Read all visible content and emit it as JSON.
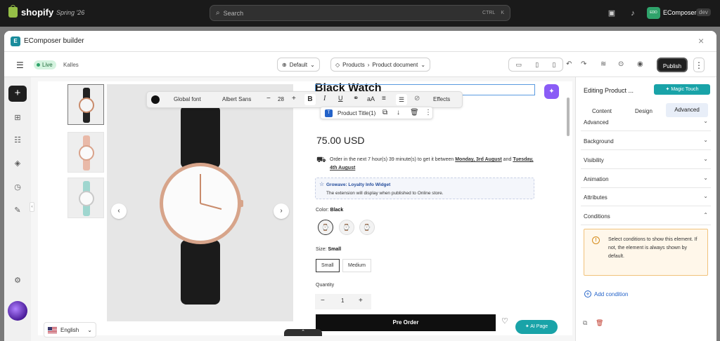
{
  "topbar": {
    "brand": "shopify",
    "edition": "Spring '26",
    "search_placeholder": "Search",
    "shortcut_ctrl": "CTRL",
    "shortcut_key": "K",
    "store_initials": "EDD",
    "store_name": "EComposer",
    "env": "dev"
  },
  "window": {
    "logo": "E",
    "title": "EComposer builder",
    "close": "×"
  },
  "toolbar": {
    "status": "Live",
    "theme": "Kalles",
    "device_mode": "Default",
    "breadcrumb_root": "Products",
    "breadcrumb_sep": "›",
    "breadcrumb_page": "Product document",
    "publish_label": "Publish"
  },
  "canvas": {
    "product_title": "Black Watch",
    "price": "75.00 USD",
    "order_text": "Order in the next 7 hour(s) 39 minute(s) to get it between",
    "order_from": "Monday, 3rd August",
    "order_and": "and",
    "order_to": "Tuesday, 4th August",
    "loyalty_title": "Growave: Loyalty Info Widget",
    "loyalty_desc": "The extension will display when published to Online store.",
    "color_label": "Color:",
    "color_value": "Black",
    "size_label": "Size:",
    "size_value": "Small",
    "size_options": [
      "Small",
      "Medium"
    ],
    "quantity_label": "Quantity",
    "quantity_value": "1",
    "preorder_label": "Pre Order",
    "ai_page_label": "AI Page",
    "language": "English"
  },
  "text_toolbar": {
    "font_scope": "Global font",
    "font_family": "Albert Sans",
    "font_size": "28",
    "bold": "B",
    "italic": "I",
    "underline": "U",
    "case": "aA",
    "effects": "Effects",
    "element_label": "Product Title(1)"
  },
  "panel": {
    "title": "Editing Product ...",
    "magic_touch": "Magic Touch",
    "tabs": [
      "Content",
      "Design",
      "Advanced"
    ],
    "sections": [
      "Advanced",
      "Background",
      "Visibility",
      "Animation",
      "Attributes"
    ],
    "conditions_title": "Conditions",
    "conditions_info": "Select conditions to show this element. If not, the element is always shown by default.",
    "add_condition": "Add condition"
  },
  "colors": {
    "accent_teal": "#19a3a8",
    "live_green": "#2fa36b",
    "link_blue": "#2463c9",
    "warning_border": "#f1c27b"
  }
}
